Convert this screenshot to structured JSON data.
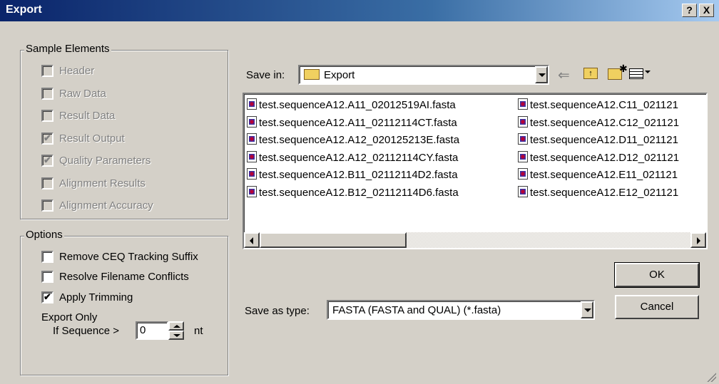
{
  "window": {
    "title": "Export",
    "help": "?",
    "close": "X"
  },
  "sample_elements": {
    "title": "Sample Elements",
    "items": [
      {
        "label": "Header",
        "checked": false
      },
      {
        "label": "Raw Data",
        "checked": false
      },
      {
        "label": "Result Data",
        "checked": false
      },
      {
        "label": "Result Output",
        "checked": true
      },
      {
        "label": "Quality Parameters",
        "checked": true
      },
      {
        "label": "Alignment Results",
        "checked": false
      },
      {
        "label": "Alignment Accuracy",
        "checked": false
      }
    ]
  },
  "options": {
    "title": "Options",
    "remove_suffix": "Remove CEQ Tracking Suffix",
    "resolve_conflicts": "Resolve Filename Conflicts",
    "apply_trimming": "Apply Trimming",
    "export_only": "Export Only",
    "if_sequence": "If Sequence >",
    "min_length": "0",
    "unit": "nt"
  },
  "save_in": {
    "label": "Save in:",
    "folder": "Export"
  },
  "files": {
    "col1": [
      "test.sequenceA12.A11_02012519AI.fasta",
      "test.sequenceA12.A11_02112114CT.fasta",
      "test.sequenceA12.A12_020125213E.fasta",
      "test.sequenceA12.A12_02112114CY.fasta",
      "test.sequenceA12.B11_02112114D2.fasta",
      "test.sequenceA12.B12_02112114D6.fasta"
    ],
    "col2": [
      "test.sequenceA12.C11_021121",
      "test.sequenceA12.C12_021121",
      "test.sequenceA12.D11_021121",
      "test.sequenceA12.D12_021121",
      "test.sequenceA12.E11_021121",
      "test.sequenceA12.E12_021121"
    ]
  },
  "save_as": {
    "label": "Save as type:",
    "value": "FASTA (FASTA and QUAL) (*.fasta)"
  },
  "buttons": {
    "ok": "OK",
    "cancel": "Cancel"
  }
}
